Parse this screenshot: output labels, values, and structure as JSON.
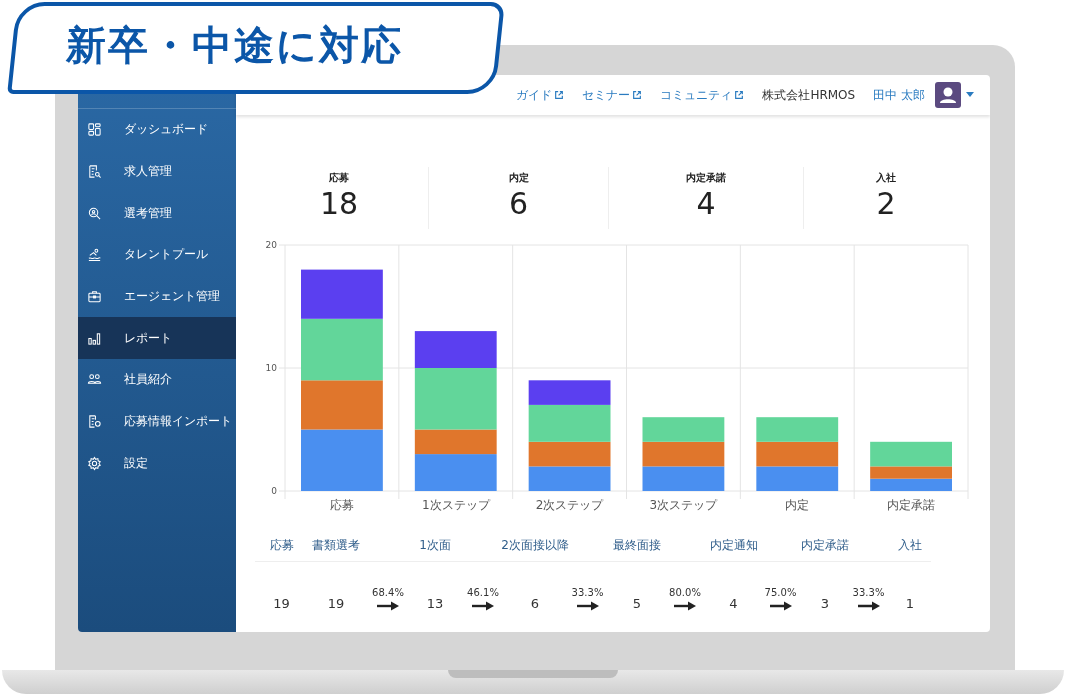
{
  "banner": {
    "title": "新卒・中途に対応"
  },
  "sidebar": {
    "items": [
      {
        "label": "ダッシュボード",
        "kind": "dashboard",
        "selected": false
      },
      {
        "label": "求人管理",
        "kind": "document",
        "selected": false
      },
      {
        "label": "選考管理",
        "kind": "magnifier",
        "selected": false
      },
      {
        "label": "タレントプール",
        "kind": "pool",
        "selected": false
      },
      {
        "label": "エージェント管理",
        "kind": "briefcase",
        "selected": false
      },
      {
        "label": "レポート",
        "kind": "chart",
        "selected": true
      },
      {
        "label": "社員紹介",
        "kind": "people",
        "selected": false
      },
      {
        "label": "応募情報インポート",
        "kind": "import",
        "selected": false
      },
      {
        "label": "設定",
        "kind": "gear",
        "selected": false
      }
    ]
  },
  "header": {
    "links": [
      {
        "label": "ガイド"
      },
      {
        "label": "セミナー"
      },
      {
        "label": "コミュニティ"
      }
    ],
    "company": "株式会社HRMOS",
    "user": "田中 太郎"
  },
  "summary": [
    {
      "label": "応募",
      "value": "18"
    },
    {
      "label": "内定",
      "value": "6"
    },
    {
      "label": "内定承諾",
      "value": "4"
    },
    {
      "label": "入社",
      "value": "2"
    }
  ],
  "chart": {
    "chart_data": {
      "type": "bar",
      "stacked": true,
      "categories": [
        "応募",
        "1次ステップ",
        "2次ステップ",
        "3次ステップ",
        "内定",
        "内定承諾"
      ],
      "ylim": [
        0,
        20
      ],
      "yticks": [
        0,
        10,
        20
      ],
      "series": [
        {
          "color": "#4a8ff0",
          "values": [
            5,
            3,
            2,
            2,
            2,
            1
          ]
        },
        {
          "color": "#e0762c",
          "values": [
            4,
            2,
            2,
            2,
            2,
            1
          ]
        },
        {
          "color": "#62d69a",
          "values": [
            5,
            5,
            3,
            2,
            2,
            2
          ]
        },
        {
          "color": "#5b3ff0",
          "values": [
            4,
            3,
            2,
            0,
            0,
            0
          ]
        }
      ]
    }
  },
  "funnel": {
    "stages": [
      {
        "label": "応募",
        "value": "19"
      },
      {
        "label": "書類選考",
        "value": "19"
      },
      {
        "label": "1次面",
        "value": "13"
      },
      {
        "label": "2次面接以降",
        "value": "6"
      },
      {
        "label": "最終面接",
        "value": "5"
      },
      {
        "label": "内定通知",
        "value": "4"
      },
      {
        "label": "内定承諾",
        "value": "3"
      },
      {
        "label": "入社",
        "value": "1"
      }
    ],
    "rates": [
      "68.4%",
      "46.1%",
      "33.3%",
      "80.0%",
      "75.0%",
      "33.3%"
    ]
  }
}
